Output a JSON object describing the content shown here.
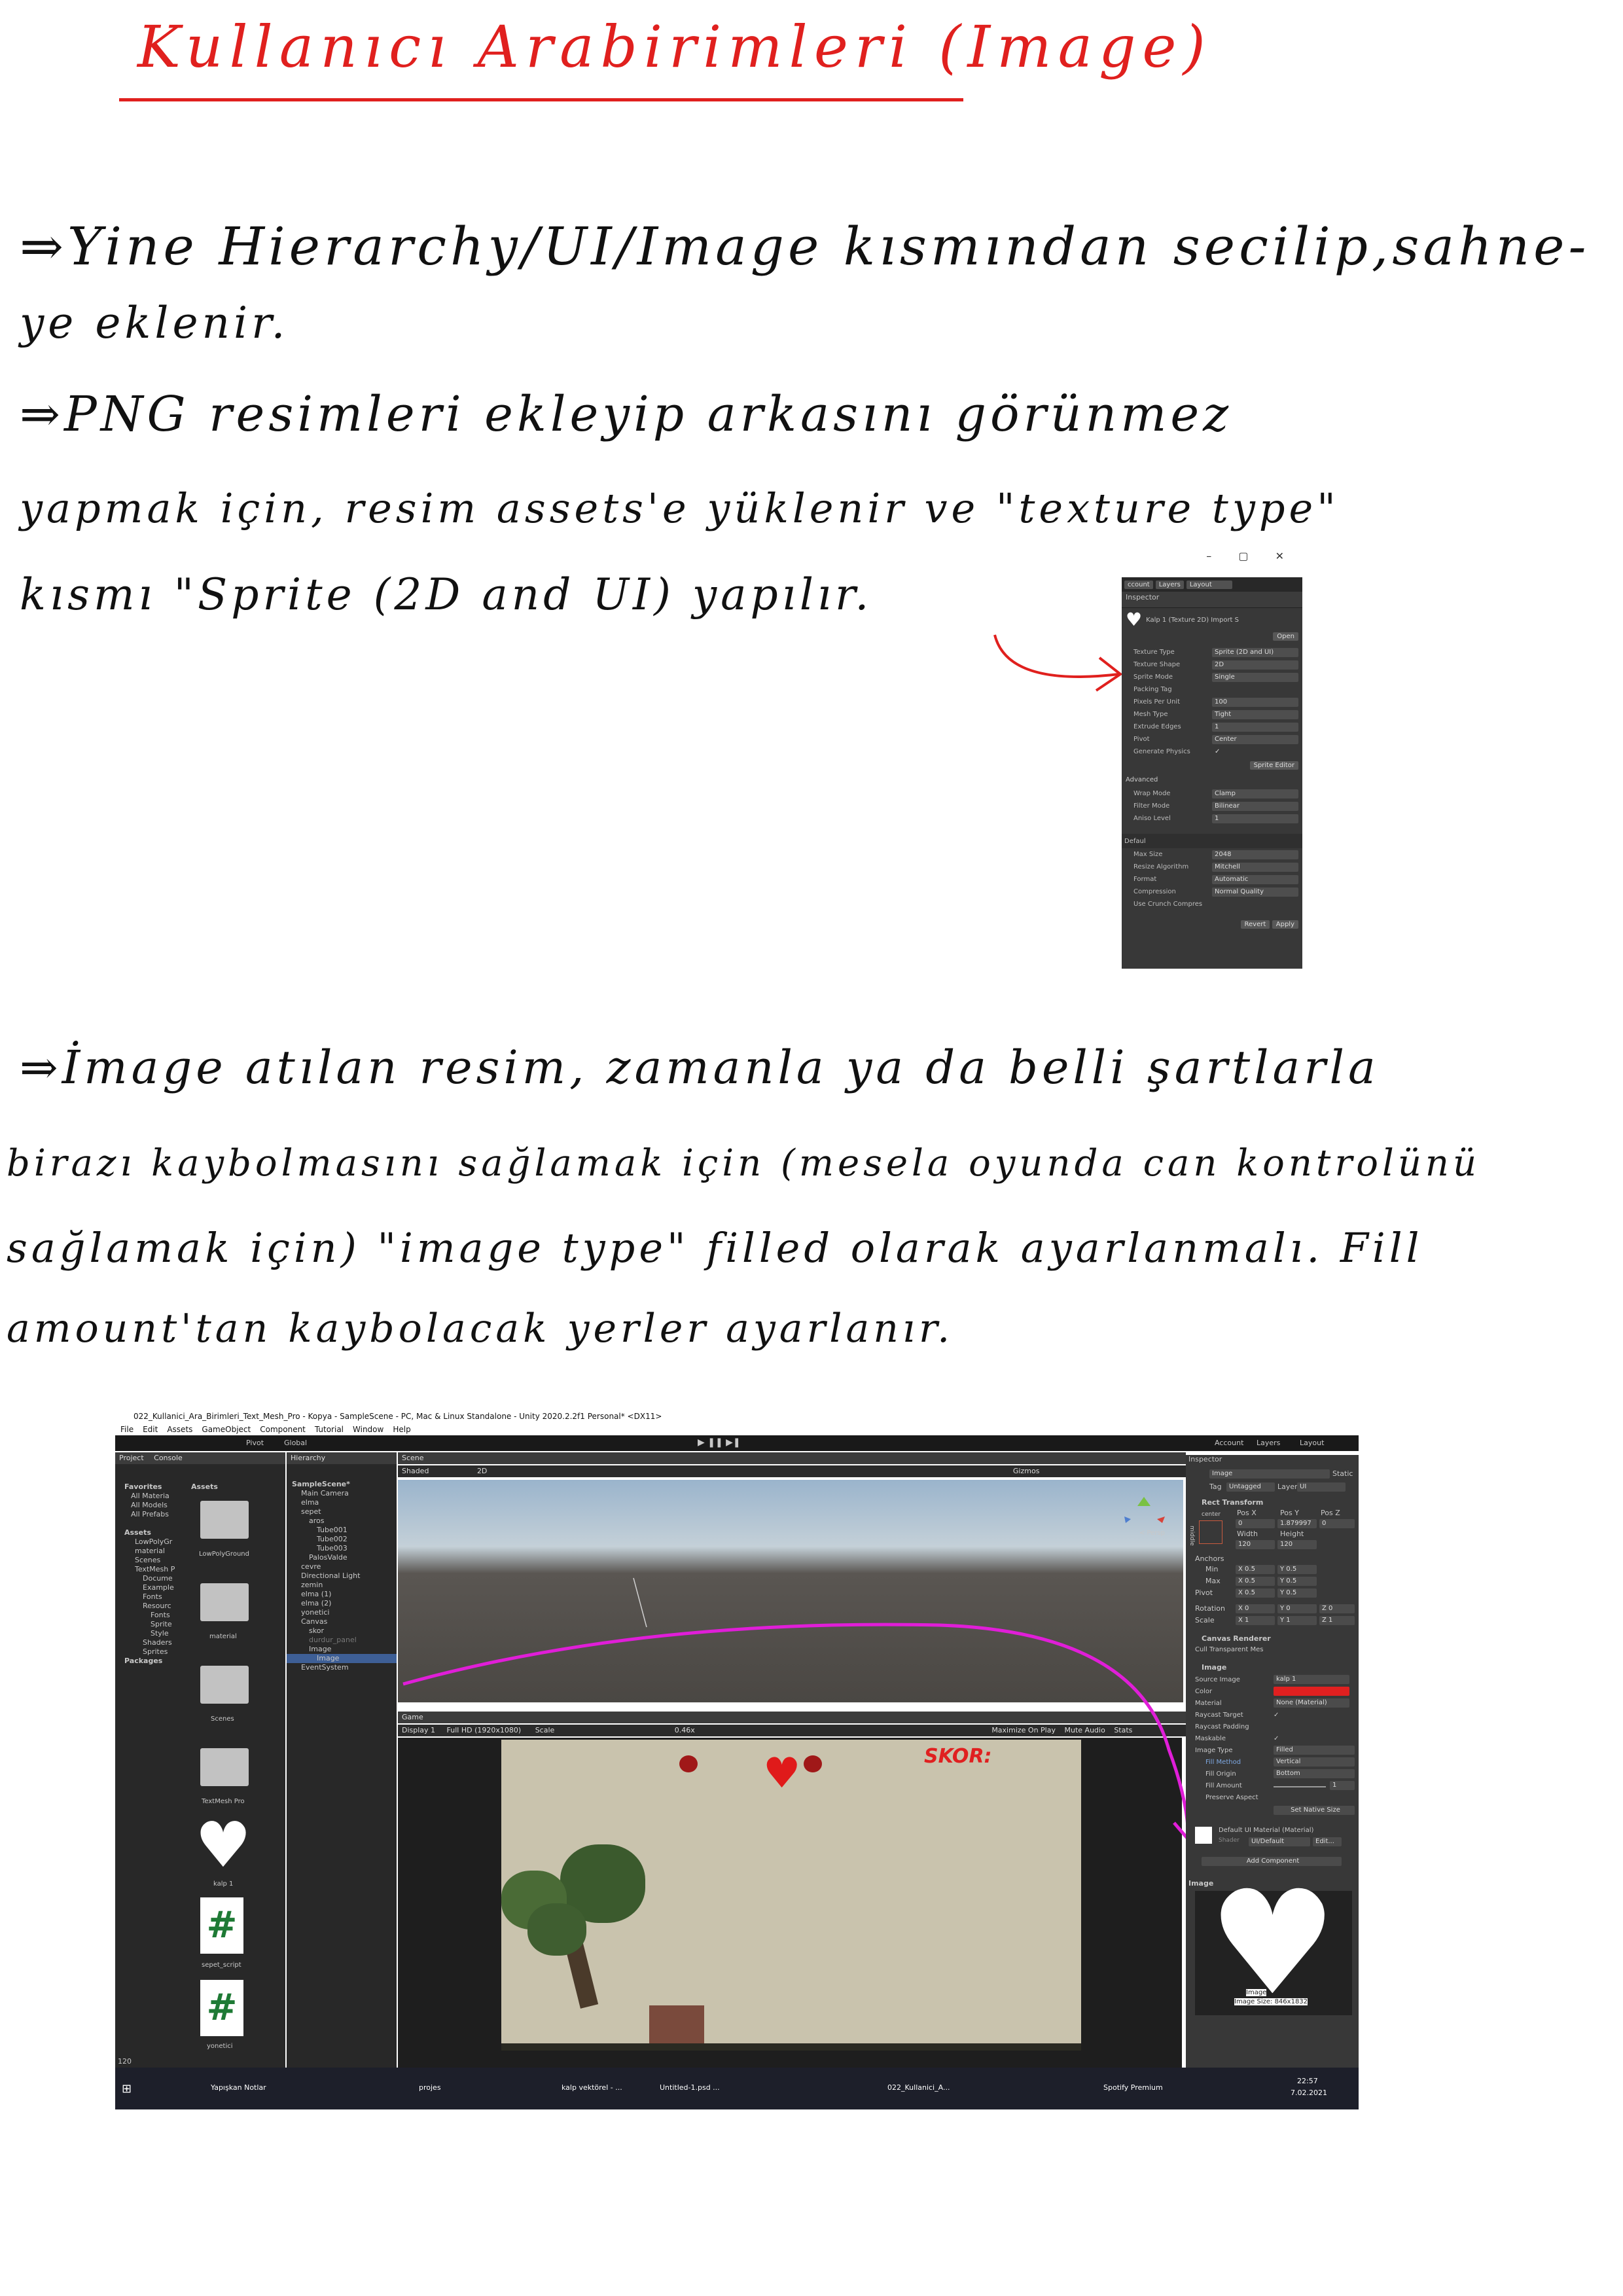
{
  "title": "Kullanıcı Arabirimleri (Image)",
  "notes": {
    "line1": "⇒Yine Hierarchy/UI/Image kısmından secilip,sahne-",
    "line2": "ye eklenir.",
    "line3": "⇒PNG resimleri ekleyip arkasını görünmez",
    "line4": "yapmak için, resim assets'e yüklenir ve \"texture type\"",
    "line5": "kısmı \"Sprite (2D and UI) yapılır.",
    "line6": "⇒İmage atılan resim, zamanla ya da belli şartlarla",
    "line7": "birazı kaybolmasını sağlamak için (mesela oyunda can kontrolünü",
    "line8": "sağlamak için) \"image type\" filled olarak ayarlanmalı. Fill",
    "line9": "amount'tan kaybolacak yerler ayarlanır."
  },
  "inspector_small": {
    "toolbar": [
      "ccount",
      "Layers",
      "Layout"
    ],
    "tab": "Inspector",
    "asset": "Kalp 1 (Texture 2D) Import S",
    "open": "Open",
    "rows": [
      {
        "k": "Texture Type",
        "v": "Sprite (2D and UI)"
      },
      {
        "k": "Texture Shape",
        "v": "2D"
      },
      {
        "k": "Sprite Mode",
        "v": "Single"
      },
      {
        "k": "Packing Tag",
        "v": ""
      },
      {
        "k": "Pixels Per Unit",
        "v": "100"
      },
      {
        "k": "Mesh Type",
        "v": "Tight"
      },
      {
        "k": "Extrude Edges",
        "v": "1"
      },
      {
        "k": "Pivot",
        "v": "Center"
      },
      {
        "k": "Generate Physics",
        "v": "✓"
      }
    ],
    "sprite_editor": "Sprite Editor",
    "advanced": "Advanced",
    "rows2": [
      {
        "k": "Wrap Mode",
        "v": "Clamp"
      },
      {
        "k": "Filter Mode",
        "v": "Bilinear"
      },
      {
        "k": "Aniso Level",
        "v": "1"
      }
    ],
    "default": "Defaul",
    "rows3": [
      {
        "k": "Max Size",
        "v": "2048"
      },
      {
        "k": "Resize Algorithm",
        "v": "Mitchell"
      },
      {
        "k": "Format",
        "v": "Automatic"
      },
      {
        "k": "Compression",
        "v": "Normal Quality"
      },
      {
        "k": "Use Crunch Compres",
        "v": ""
      }
    ],
    "revert": "Revert",
    "apply": "Apply"
  },
  "editor": {
    "window_title": "022_Kullanici_Ara_Birimleri_Text_Mesh_Pro - Kopya - SampleScene - PC, Mac & Linux Standalone - Unity 2020.2.2f1 Personal* <DX11>",
    "menu": [
      "File",
      "Edit",
      "Assets",
      "GameObject",
      "Component",
      "Tutorial",
      "Window",
      "Help"
    ],
    "toolbar": {
      "pivot": "Pivot",
      "global": "Global",
      "account": "Account",
      "layers": "Layers",
      "layout": "Layout"
    },
    "project_tab": "Project",
    "console_tab": "Console",
    "favorites": "Favorites",
    "fav_items": [
      "All Materia",
      "All Models",
      "All Prefabs"
    ],
    "assets_label": "Assets",
    "asset_tree": [
      "LowPolyGr",
      "material",
      "Scenes",
      "TextMesh P",
      "Docume",
      "Example",
      "Fonts",
      "Resourc",
      "Fonts",
      "Sprite",
      "Style",
      "Shaders",
      "Sprites",
      "Packages"
    ],
    "asset_grid": [
      "LowPolyGround",
      "material",
      "Scenes",
      "TextMesh Pro",
      "kalp 1",
      "sepet_script",
      "yonetici"
    ],
    "hierarchy_tab": "Hierarchy",
    "hierarchy": [
      "SampleScene*",
      "Main Camera",
      "elma",
      "sepet",
      "aros",
      "Tube001",
      "Tube002",
      "Tube003",
      "PalosValde",
      "cevre",
      "Directional Light",
      "zemin",
      "elma (1)",
      "elma (2)",
      "yonetici",
      "Canvas",
      "skor",
      "durdur_panel",
      "Image",
      "Image",
      "EventSystem"
    ],
    "scene_tab": "Scene",
    "shaded": "Shaded",
    "mode2d": "2D",
    "gizmos": "Gizmos",
    "persp": "< Persp",
    "game_tab": "Game",
    "display": "Display 1",
    "resolution": "Full HD (1920x1080)",
    "scale": "Scale",
    "scale_value": "0.46x",
    "maximize": "Maximize On Play",
    "mute": "Mute Audio",
    "stats": "Stats",
    "skor": "SKOR:",
    "inspector_tab": "Inspector",
    "obj_name": "Image",
    "static": "Static",
    "tag": "Tag",
    "tag_value": "Untagged",
    "layer": "Layer",
    "layer_value": "UI",
    "rect_transform": "Rect Transform",
    "center": "center",
    "middle": "middle",
    "posx": "Pos X",
    "posy": "Pos Y",
    "posz": "Pos Z",
    "posx_v": "0",
    "posy_v": "1.879997",
    "posz_v": "0",
    "width": "Width",
    "height": "Height",
    "width_v": "120",
    "height_v": "120",
    "anchors": "Anchors",
    "min": "Min",
    "max": "Max",
    "pivot": "Pivot",
    "min_v": [
      "X 0.5",
      "Y 0.5"
    ],
    "max_v": [
      "X 0.5",
      "Y 0.5"
    ],
    "pivot_v": [
      "X 0.5",
      "Y 0.5"
    ],
    "rotation": "Rotation",
    "rotation_v": [
      "X 0",
      "Y 0",
      "Z 0"
    ],
    "scale_row": "Scale",
    "scale_v": [
      "X 1",
      "Y 1",
      "Z 1"
    ],
    "canvas_renderer": "Canvas Renderer",
    "cull": "Cull Transparent Mes",
    "image_comp": "Image",
    "image_rows": [
      {
        "k": "Source Image",
        "v": "kalp 1"
      },
      {
        "k": "Color",
        "v": ""
      },
      {
        "k": "Material",
        "v": "None (Material)"
      },
      {
        "k": "Raycast Target",
        "v": "✓"
      },
      {
        "k": "Raycast Padding",
        "v": ""
      },
      {
        "k": "Maskable",
        "v": "✓"
      },
      {
        "k": "Image Type",
        "v": "Filled"
      },
      {
        "k": "Fill Method",
        "v": "Vertical"
      },
      {
        "k": "Fill Origin",
        "v": "Bottom"
      },
      {
        "k": "Fill Amount",
        "v": "1"
      },
      {
        "k": "Preserve Aspect",
        "v": ""
      }
    ],
    "set_native": "Set Native Size",
    "default_mat": "Default UI Material (Material)",
    "shader": "Shader",
    "shader_v": "UI/Default",
    "edit": "Edit...",
    "add_component": "Add Component",
    "preview_label": "Image",
    "preview_caption": "Image",
    "preview_size": "Image Size: 846x1832",
    "count": "120",
    "taskbar": [
      "Yapışkan Notlar",
      "projes",
      "kalp vektörel - ...",
      "Untitled-1.psd ...",
      "022_Kullanici_A...",
      "Spotify Premium"
    ],
    "clock": "22:57",
    "date": "7.02.2021"
  },
  "colors": {
    "accent": "#e0201e",
    "magenta": "#e01ed8",
    "heart": "#e01a1a",
    "unity_bg": "#282828"
  }
}
